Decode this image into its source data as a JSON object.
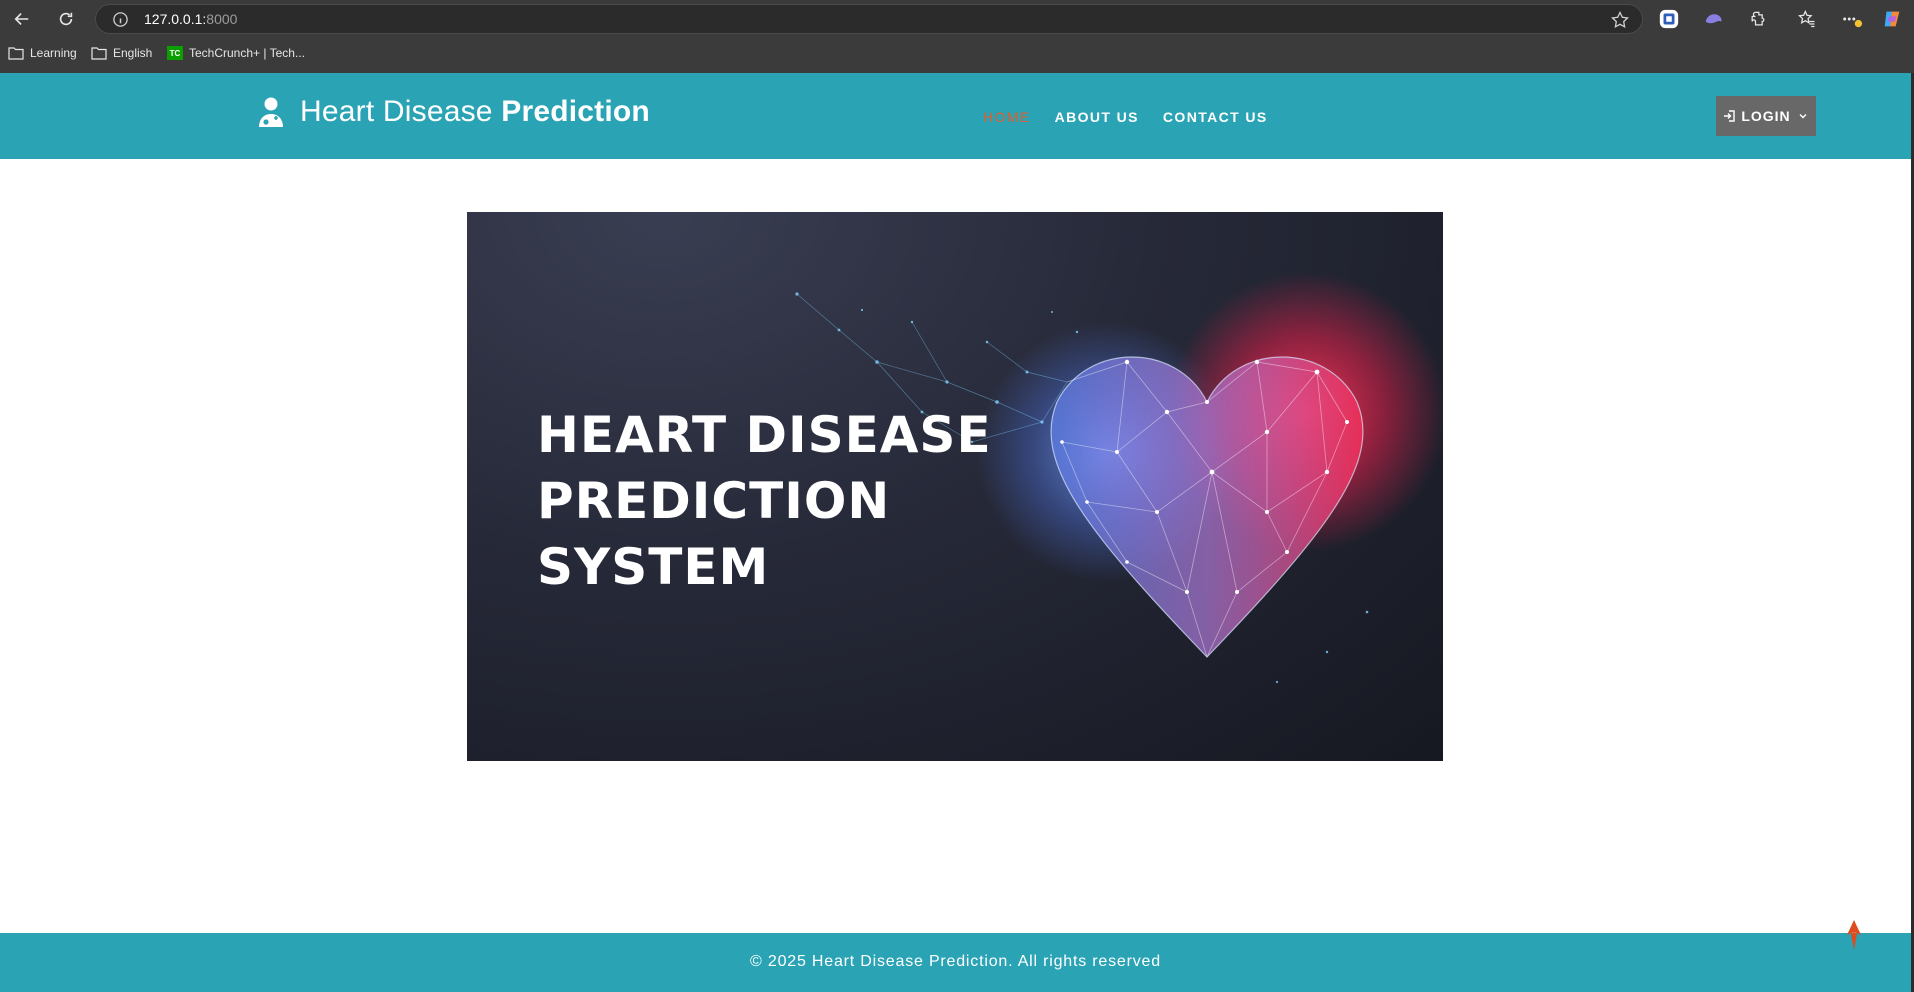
{
  "browser": {
    "url_host": "127.0.0.1:",
    "url_port": "8000",
    "bookmarks": [
      {
        "label": "Learning",
        "icon": "folder-icon"
      },
      {
        "label": "English",
        "icon": "folder-icon"
      },
      {
        "label": "TechCrunch+ | Tech...",
        "icon": "techcrunch-icon",
        "icon_text": "TC"
      }
    ]
  },
  "header": {
    "brand_part1": "Heart Disease",
    "brand_part2": "Prediction",
    "nav": [
      {
        "label": "HOME",
        "active": true
      },
      {
        "label": "ABOUT US",
        "active": false
      },
      {
        "label": "CONTACT US",
        "active": false
      }
    ],
    "login_label": "LOGIN"
  },
  "hero": {
    "title_line1": "HEART DISEASE",
    "title_line2": "PREDICTION",
    "title_line3": "SYSTEM"
  },
  "footer": {
    "copyright": "© 2025 Heart Disease Prediction. All rights reserved"
  },
  "colors": {
    "brand_teal": "#2aa3b5",
    "nav_active": "#e25c2b",
    "login_bg": "#686868",
    "hero_bg": "#1f2230"
  }
}
